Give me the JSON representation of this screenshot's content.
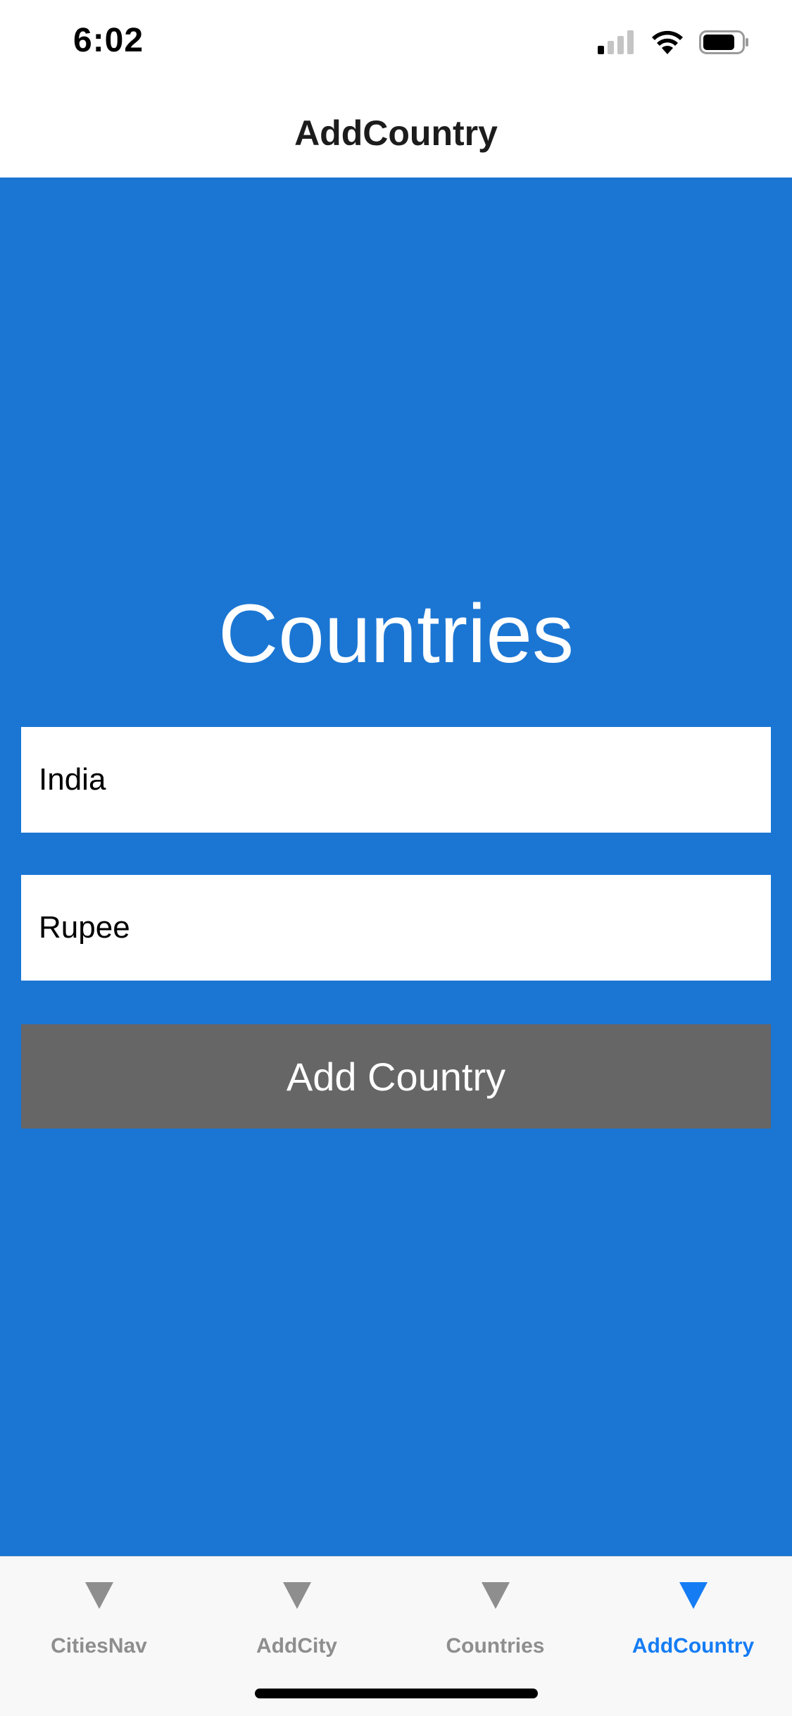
{
  "status_bar": {
    "time": "6:02",
    "icons": [
      "cellular-signal-icon",
      "wifi-icon",
      "battery-icon"
    ]
  },
  "nav": {
    "title": "AddCountry"
  },
  "main": {
    "heading": "Countries",
    "country_field": {
      "value": "India"
    },
    "currency_field": {
      "value": "Rupee"
    },
    "add_button_label": "Add Country"
  },
  "tabs": [
    {
      "label": "CitiesNav",
      "icon": "triangle-down-icon",
      "active": false
    },
    {
      "label": "AddCity",
      "icon": "triangle-down-icon",
      "active": false
    },
    {
      "label": "Countries",
      "icon": "triangle-down-icon",
      "active": false
    },
    {
      "label": "AddCountry",
      "icon": "triangle-down-icon",
      "active": true
    }
  ],
  "colors": {
    "background_blue": "#1b76d3",
    "button_gray": "#666666",
    "tab_active": "#157cf4",
    "tab_inactive": "#8e8e8e"
  }
}
